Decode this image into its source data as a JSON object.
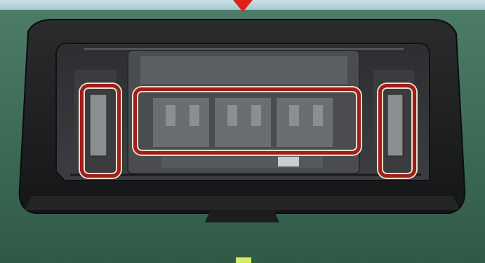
{
  "image": {
    "description_icon": "printhead-tray-photo"
  },
  "colors": {
    "background_green": "#3f6d58",
    "tray_black": "#1b1c1e",
    "highlight_red": "#a31d1a",
    "marker_red": "#e0201a",
    "marker_yellow": "#d8ea62"
  },
  "annotations": [
    {
      "name": "left-connector-highlight"
    },
    {
      "name": "nozzle-area-highlight"
    },
    {
      "name": "right-connector-highlight"
    }
  ]
}
